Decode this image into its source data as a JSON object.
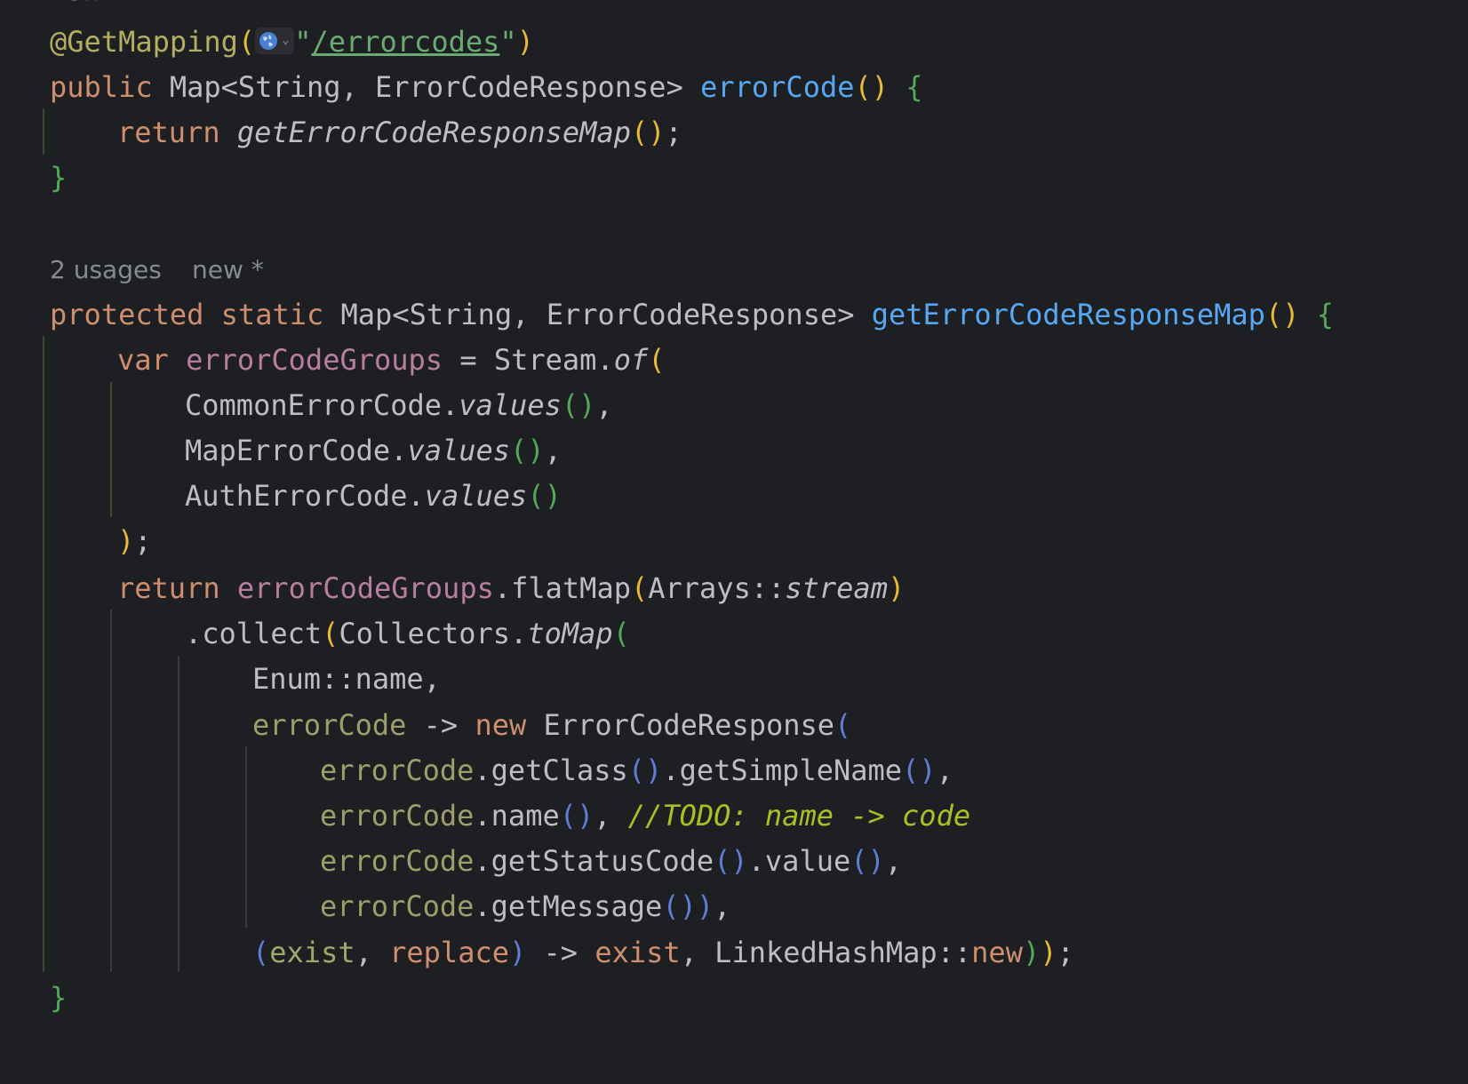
{
  "editor": {
    "top_hint": "new",
    "annotation_line": {
      "annotation": "@GetMapping",
      "open_paren": "(",
      "quote_open": "\"",
      "url": "/errorcodes",
      "quote_close": "\"",
      "close_paren": ")"
    },
    "method1": {
      "modifier": "public",
      "return_type": "Map<String, ErrorCodeResponse>",
      "name": "errorCode",
      "parens": "()",
      "brace_open": "{",
      "body_keyword": "return",
      "body_call": "getErrorCodeResponseMap",
      "body_parens": "()",
      "body_end": ";",
      "brace_close": "}"
    },
    "hints": {
      "usages": "2 usages",
      "status": "new *"
    },
    "method2": {
      "modifier1": "protected",
      "modifier2": "static",
      "return_type": "Map<String, ErrorCodeResponse>",
      "name": "getErrorCodeResponseMap",
      "parens": "()",
      "brace_open": "{",
      "var_kw": "var",
      "var_name": "errorCodeGroups",
      "assign": " = ",
      "stream": "Stream.",
      "of": "of",
      "open": "(",
      "items": [
        {
          "cls": "CommonErrorCode.",
          "method": "values",
          "parens": "()",
          "sep": ","
        },
        {
          "cls": "MapErrorCode.",
          "method": "values",
          "parens": "()",
          "sep": ","
        },
        {
          "cls": "AuthErrorCode.",
          "method": "values",
          "parens": "()",
          "sep": ""
        }
      ],
      "close": ")",
      "close_semi": ";",
      "return_kw": "return",
      "return_var": "errorCodeGroups",
      "flatmap": ".flatMap",
      "flatmap_open": "(",
      "arrays_ref": "Arrays::",
      "stream_ref": "stream",
      "flatmap_close": ")",
      "collect": ".collect",
      "collect_open": "(",
      "collectors": "Collectors.",
      "tomap": "toMap",
      "tomap_open": "(",
      "enum_ref": "Enum::name,",
      "lambda_param": "errorCode",
      "arrow": " -> ",
      "new_kw": "new",
      "ctor": " ErrorCodeResponse",
      "ctor_open": "(",
      "args": [
        {
          "recv": "errorCode",
          "call": ".getClass",
          "p1": "()",
          "call2": ".getSimpleName",
          "p2": "()",
          "tail": ","
        },
        {
          "recv": "errorCode",
          "call": ".name",
          "p1": "()",
          "tail": ", ",
          "comment": "//TODO: name -> code"
        },
        {
          "recv": "errorCode",
          "call": ".getStatusCode",
          "p1": "()",
          "call2": ".value",
          "p2": "()",
          "tail": ","
        },
        {
          "recv": "errorCode",
          "call": ".getMessage",
          "p1": "()",
          "p_close": ")",
          "tail": ","
        }
      ],
      "merge_open": "(",
      "merge_a": "exist",
      "merge_comma": ", ",
      "merge_b": "replace",
      "merge_close": ")",
      "merge_arrow": " -> ",
      "merge_result": "exist",
      "merge_sep": ", ",
      "lhm": "LinkedHashMap::",
      "lhm_new": "new",
      "final_close1": ")",
      "final_close2": ")",
      "final_semi": ";",
      "brace_close": "}"
    }
  }
}
